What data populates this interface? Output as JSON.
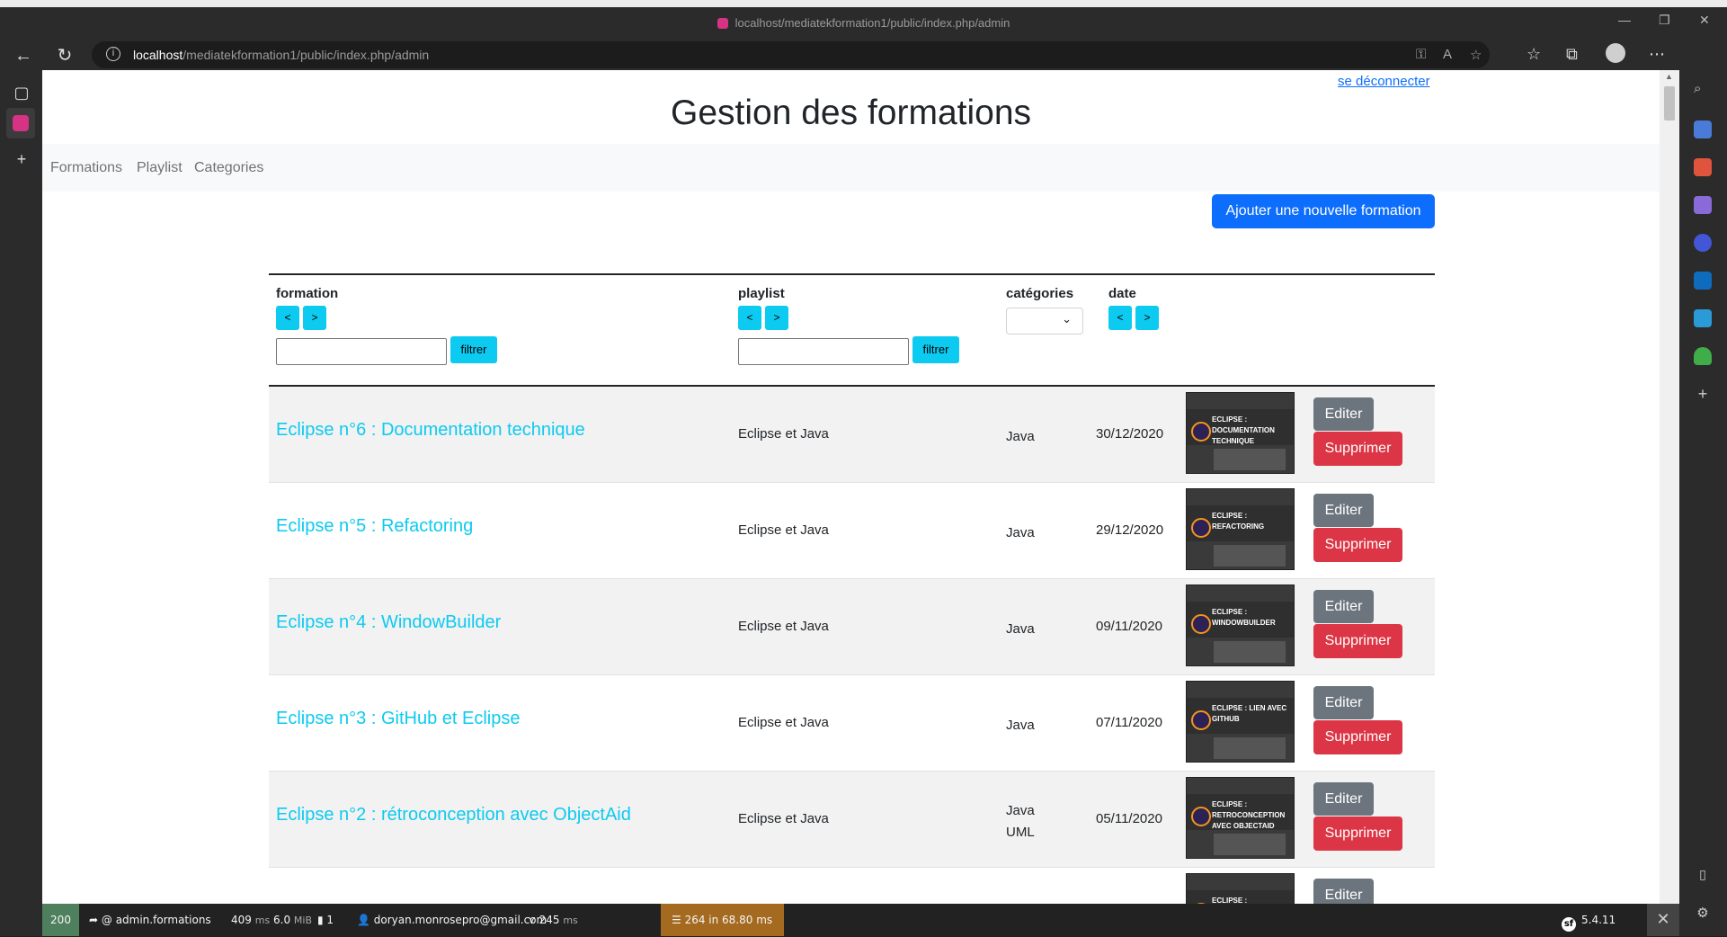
{
  "browser": {
    "window_title": "localhost/mediatekformation1/public/index.php/admin",
    "url_host": "localhost",
    "url_path": "/mediatekformation1/public/index.php/admin"
  },
  "page": {
    "logout_link": "se déconnecter",
    "title": "Gestion des formations",
    "nav": [
      "Formations",
      "Playlist",
      "Categories"
    ],
    "add_button": "Ajouter une nouvelle formation"
  },
  "table": {
    "headers": {
      "formation": "formation",
      "playlist": "playlist",
      "categories": "catégories",
      "date": "date"
    },
    "sort_asc": "<",
    "sort_desc": ">",
    "filter_button": "filtrer",
    "edit_label": "Editer",
    "delete_label": "Supprimer",
    "rows": [
      {
        "title": "Eclipse n°6 : Documentation technique",
        "playlist": "Eclipse et Java",
        "categories": [
          "Java"
        ],
        "date": "30/12/2020",
        "thumb_text": "ECLIPSE : DOCUMENTATION TECHNIQUE"
      },
      {
        "title": "Eclipse n°5 : Refactoring",
        "playlist": "Eclipse et Java",
        "categories": [
          "Java"
        ],
        "date": "29/12/2020",
        "thumb_text": "ECLIPSE : REFACTORING"
      },
      {
        "title": "Eclipse n°4 : WindowBuilder",
        "playlist": "Eclipse et Java",
        "categories": [
          "Java"
        ],
        "date": "09/11/2020",
        "thumb_text": "ECLIPSE : WINDOWBUILDER"
      },
      {
        "title": "Eclipse n°3 : GitHub et Eclipse",
        "playlist": "Eclipse et Java",
        "categories": [
          "Java"
        ],
        "date": "07/11/2020",
        "thumb_text": "ECLIPSE : LIEN AVEC GITHUB"
      },
      {
        "title": "Eclipse n°2 : rétroconception avec ObjectAid",
        "playlist": "Eclipse et Java",
        "categories": [
          "Java",
          "UML"
        ],
        "date": "05/11/2020",
        "thumb_text": "ECLIPSE : RETROCONCEPTION AVEC OBJECTAID"
      },
      {
        "title": "",
        "playlist": "",
        "categories": [],
        "date": "",
        "thumb_text": "ECLIPSE :"
      }
    ]
  },
  "symfony_toolbar": {
    "status": "200",
    "route": "@ admin.formations",
    "time": "409",
    "time_unit": "ms",
    "memory": "6.0",
    "memory_unit": "MiB",
    "forms": "1",
    "user": "doryan.monrosepro@gmail.com",
    "render_time": "245",
    "render_unit": "ms",
    "db": "264 in 68.80 ms",
    "version": "5.4.11"
  }
}
